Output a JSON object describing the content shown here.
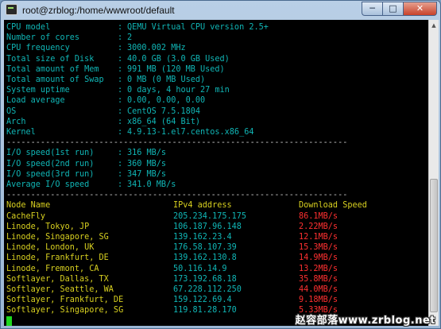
{
  "window": {
    "title": "root@zrblog:/home/wwwroot/default"
  },
  "colors": {
    "info": "#10b6b6",
    "separator": "#c8c8c8",
    "node": "#d8d020",
    "ip": "#10b6b6",
    "speed": "#ff3030",
    "cursor": "#1ed81e"
  },
  "system_info": [
    {
      "label": "CPU model",
      "value": "QEMU Virtual CPU version 2.5+"
    },
    {
      "label": "Number of cores",
      "value": "2"
    },
    {
      "label": "CPU frequency",
      "value": "3000.002 MHz"
    },
    {
      "label": "Total size of Disk",
      "value": "40.0 GB (3.0 GB Used)"
    },
    {
      "label": "Total amount of Mem",
      "value": "991 MB (120 MB Used)"
    },
    {
      "label": "Total amount of Swap",
      "value": "0 MB (0 MB Used)"
    },
    {
      "label": "System uptime",
      "value": "0 days, 4 hour 27 min"
    },
    {
      "label": "Load average",
      "value": "0.00, 0.00, 0.00"
    },
    {
      "label": "OS",
      "value": "CentOS 7.5.1804"
    },
    {
      "label": "Arch",
      "value": "x86_64 (64 Bit)"
    },
    {
      "label": "Kernel",
      "value": "4.9.13-1.el7.centos.x86_64"
    }
  ],
  "separator_line": "----------------------------------------------------------------------",
  "io_tests": [
    {
      "label": "I/O speed(1st run)",
      "value": "316 MB/s"
    },
    {
      "label": "I/O speed(2nd run)",
      "value": "360 MB/s"
    },
    {
      "label": "I/O speed(3rd run)",
      "value": "347 MB/s"
    },
    {
      "label": "Average I/O speed",
      "value": "341.0 MB/s"
    }
  ],
  "speed_table": {
    "headers": {
      "node": "Node Name",
      "ip": "IPv4 address",
      "speed": "Download Speed"
    },
    "rows": [
      {
        "node": "CacheFly",
        "ip": "205.234.175.175",
        "speed": "86.1MB/s"
      },
      {
        "node": "Linode, Tokyo, JP",
        "ip": "106.187.96.148",
        "speed": "2.22MB/s"
      },
      {
        "node": "Linode, Singapore, SG",
        "ip": "139.162.23.4",
        "speed": "12.1MB/s"
      },
      {
        "node": "Linode, London, UK",
        "ip": "176.58.107.39",
        "speed": "15.3MB/s"
      },
      {
        "node": "Linode, Frankfurt, DE",
        "ip": "139.162.130.8",
        "speed": "14.9MB/s"
      },
      {
        "node": "Linode, Fremont, CA",
        "ip": "50.116.14.9",
        "speed": "13.2MB/s"
      },
      {
        "node": "Softlayer, Dallas, TX",
        "ip": "173.192.68.18",
        "speed": "35.8MB/s"
      },
      {
        "node": "Softlayer, Seattle, WA",
        "ip": "67.228.112.250",
        "speed": "44.0MB/s"
      },
      {
        "node": "Softlayer, Frankfurt, DE",
        "ip": "159.122.69.4",
        "speed": "9.18MB/s"
      },
      {
        "node": "Softlayer, Singapore, SG",
        "ip": "119.81.28.170",
        "speed": "5.33MB/s"
      }
    ]
  },
  "watermark": "赵容部落www.zrblog.net"
}
